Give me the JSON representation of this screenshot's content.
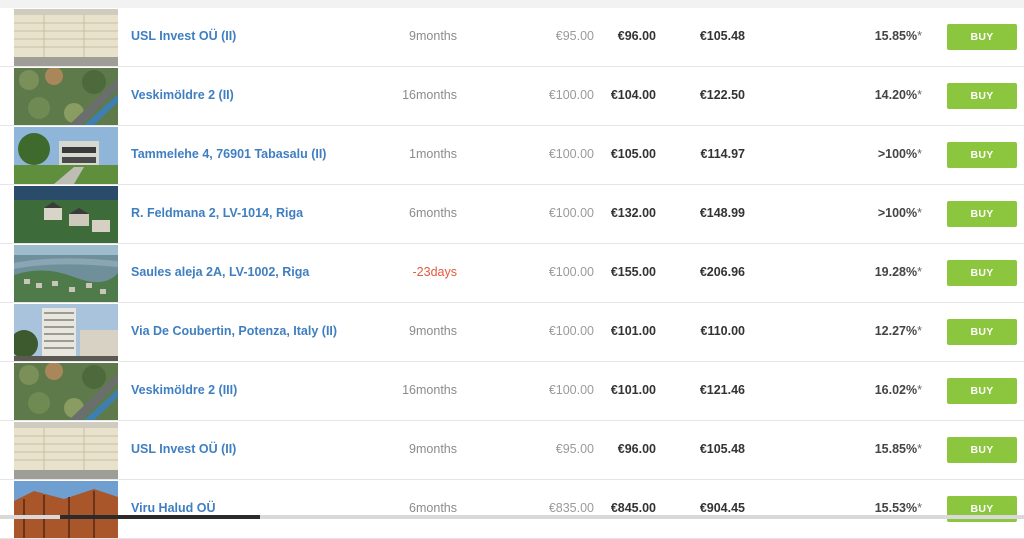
{
  "colors": {
    "link": "#3f7fc1",
    "buy_button": "#8cc63f",
    "negative_term": "#e8593c"
  },
  "buy_label": "BUY",
  "rows": [
    {
      "name": "USL Invest OÜ (II)",
      "term": "9months",
      "price": "€95.00",
      "ask": "€96.00",
      "expected": "€105.48",
      "xirr": "15.85%",
      "xirr_note": "*",
      "thumb": "lumber-stack-image"
    },
    {
      "name": "Veskimöldre 2 (II)",
      "term": "16months",
      "price": "€100.00",
      "ask": "€104.00",
      "expected": "€122.50",
      "xirr": "14.20%",
      "xirr_note": "*",
      "thumb": "aerial-forest-image"
    },
    {
      "name": "Tammelehe 4, 76901 Tabasalu (II)",
      "term": "1months",
      "price": "€100.00",
      "ask": "€105.00",
      "expected": "€114.97",
      "xirr": ">100%",
      "xirr_note": "*",
      "thumb": "modern-house-image"
    },
    {
      "name": "R. Feldmana 2, LV-1014, Riga",
      "term": "6months",
      "price": "€100.00",
      "ask": "€132.00",
      "expected": "€148.99",
      "xirr": ">100%",
      "xirr_note": "*",
      "thumb": "aerial-houses-image"
    },
    {
      "name": "Saules aleja 2A, LV-1002, Riga",
      "term": "-23days",
      "price": "€100.00",
      "ask": "€155.00",
      "expected": "€206.96",
      "xirr": "19.28%",
      "xirr_note": "*",
      "thumb": "aerial-city-image"
    },
    {
      "name": "Via De Coubertin, Potenza, Italy (II)",
      "term": "9months",
      "price": "€100.00",
      "ask": "€101.00",
      "expected": "€110.00",
      "xirr": "12.27%",
      "xirr_note": "*",
      "thumb": "apartment-tower-image"
    },
    {
      "name": "Veskimöldre 2 (III)",
      "term": "16months",
      "price": "€100.00",
      "ask": "€101.00",
      "expected": "€121.46",
      "xirr": "16.02%",
      "xirr_note": "*",
      "thumb": "aerial-forest-image"
    },
    {
      "name": "USL Invest OÜ (II)",
      "term": "9months",
      "price": "€95.00",
      "ask": "€96.00",
      "expected": "€105.48",
      "xirr": "15.85%",
      "xirr_note": "*",
      "thumb": "lumber-stack-image"
    },
    {
      "name": "Viru Halud OÜ",
      "term": "6months",
      "price": "€835.00",
      "ask": "€845.00",
      "expected": "€904.45",
      "xirr": "15.53%",
      "xirr_note": "*",
      "thumb": "timber-building-image"
    }
  ]
}
